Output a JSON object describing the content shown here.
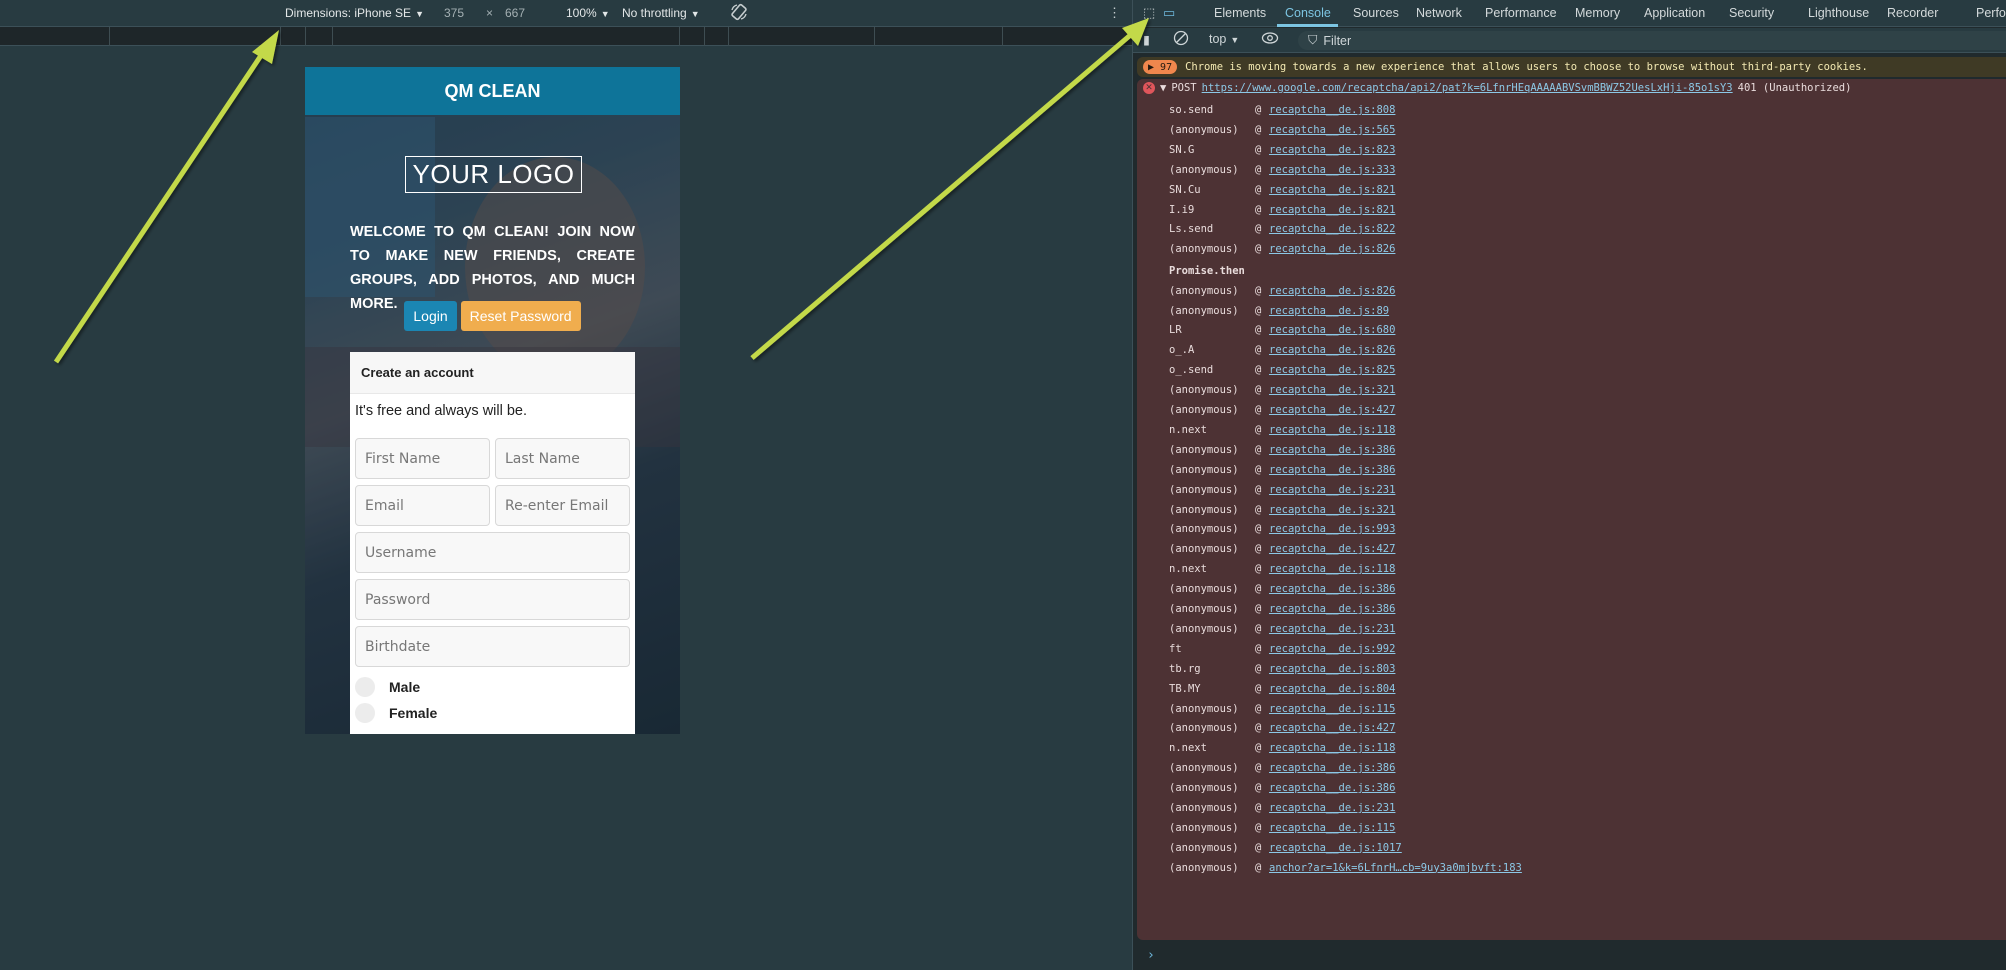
{
  "device_toolbar": {
    "dimensions_label": "Dimensions: iPhone SE",
    "width": "375",
    "times": "×",
    "height": "667",
    "zoom": "100%",
    "throttling": "No throttling",
    "rotate_icon": "rotate-icon",
    "more_icon": "⋮"
  },
  "page": {
    "header_title": "QM CLEAN",
    "logo_text": "YOUR LOGO",
    "welcome_text": "Welcome to QM Clean! Join now to make new friends, create groups, add photos, and much more.",
    "login_label": "Login",
    "reset_label": "Reset Password",
    "card_title": "Create an account",
    "card_subtitle": "It's free and always will be.",
    "fields": {
      "first_name": "First Name",
      "last_name": "Last Name",
      "email": "Email",
      "reenter_email": "Re-enter Email",
      "username": "Username",
      "password": "Password",
      "birthdate": "Birthdate"
    },
    "gender_options": [
      "Male",
      "Female"
    ]
  },
  "devtools": {
    "tabs": [
      "Elements",
      "Console",
      "Sources",
      "Network",
      "Performance",
      "Memory",
      "Application",
      "Security",
      "Lighthouse",
      "Recorder",
      "Perfo"
    ],
    "active_tab": "Console",
    "context": "top",
    "filter_placeholder": "Filter",
    "warning": {
      "count": "97",
      "text": "Chrome is moving towards a new experience that allows users to choose to browse without third-party cookies."
    },
    "error": {
      "method": "POST",
      "url": "https://www.google.com/recaptcha/api2/pat?k=6LfnrHEqAAAAABVSvmBBWZ52UesLxHji-85o1sY3",
      "status": "401 (Unauthorized)",
      "async_label": "Promise.then",
      "frames": [
        {
          "fn": "so.send",
          "src": "recaptcha__de.js:808"
        },
        {
          "fn": "(anonymous)",
          "src": "recaptcha__de.js:565"
        },
        {
          "fn": "SN.G",
          "src": "recaptcha__de.js:823"
        },
        {
          "fn": "(anonymous)",
          "src": "recaptcha__de.js:333"
        },
        {
          "fn": "SN.Cu",
          "src": "recaptcha__de.js:821"
        },
        {
          "fn": "I.i9",
          "src": "recaptcha__de.js:821"
        },
        {
          "fn": "Ls.send",
          "src": "recaptcha__de.js:822"
        },
        {
          "fn": "(anonymous)",
          "src": "recaptcha__de.js:826"
        },
        {
          "fn": "(anonymous)",
          "src": "recaptcha__de.js:826"
        },
        {
          "fn": "(anonymous)",
          "src": "recaptcha__de.js:89"
        },
        {
          "fn": "LR",
          "src": "recaptcha__de.js:680"
        },
        {
          "fn": "o_.A",
          "src": "recaptcha__de.js:826"
        },
        {
          "fn": "o_.send",
          "src": "recaptcha__de.js:825"
        },
        {
          "fn": "(anonymous)",
          "src": "recaptcha__de.js:321"
        },
        {
          "fn": "(anonymous)",
          "src": "recaptcha__de.js:427"
        },
        {
          "fn": "n.next",
          "src": "recaptcha__de.js:118"
        },
        {
          "fn": "(anonymous)",
          "src": "recaptcha__de.js:386"
        },
        {
          "fn": "(anonymous)",
          "src": "recaptcha__de.js:386"
        },
        {
          "fn": "(anonymous)",
          "src": "recaptcha__de.js:231"
        },
        {
          "fn": "(anonymous)",
          "src": "recaptcha__de.js:321"
        },
        {
          "fn": "(anonymous)",
          "src": "recaptcha__de.js:993"
        },
        {
          "fn": "(anonymous)",
          "src": "recaptcha__de.js:427"
        },
        {
          "fn": "n.next",
          "src": "recaptcha__de.js:118"
        },
        {
          "fn": "(anonymous)",
          "src": "recaptcha__de.js:386"
        },
        {
          "fn": "(anonymous)",
          "src": "recaptcha__de.js:386"
        },
        {
          "fn": "(anonymous)",
          "src": "recaptcha__de.js:231"
        },
        {
          "fn": "ft",
          "src": "recaptcha__de.js:992"
        },
        {
          "fn": "tb.rg",
          "src": "recaptcha__de.js:803"
        },
        {
          "fn": "TB.MY",
          "src": "recaptcha__de.js:804"
        },
        {
          "fn": "(anonymous)",
          "src": "recaptcha__de.js:115"
        },
        {
          "fn": "(anonymous)",
          "src": "recaptcha__de.js:427"
        },
        {
          "fn": "n.next",
          "src": "recaptcha__de.js:118"
        },
        {
          "fn": "(anonymous)",
          "src": "recaptcha__de.js:386"
        },
        {
          "fn": "(anonymous)",
          "src": "recaptcha__de.js:386"
        },
        {
          "fn": "(anonymous)",
          "src": "recaptcha__de.js:231"
        },
        {
          "fn": "(anonymous)",
          "src": "recaptcha__de.js:115"
        },
        {
          "fn": "(anonymous)",
          "src": "recaptcha__de.js:1017"
        },
        {
          "fn": "(anonymous)",
          "src": "anchor?ar=1&k=6LfnrH…cb=9uy3a0mjbvft:183"
        }
      ]
    },
    "prompt": "›"
  },
  "colors": {
    "header_blue": "#0e7499",
    "login_blue": "#1b86b3",
    "reset_orange": "#f0ad4e",
    "annotation_arrow": "#c3d94a",
    "error_bg": "#4d3234",
    "link": "#8cc8e6"
  }
}
